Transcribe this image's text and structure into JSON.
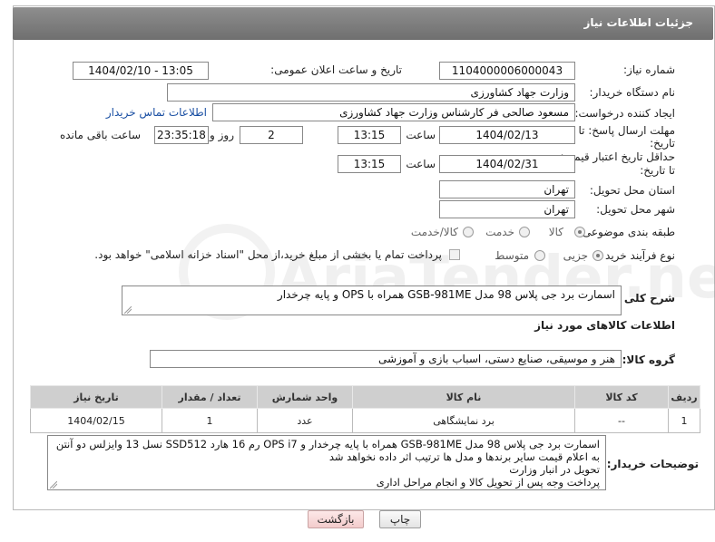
{
  "header": {
    "title": "جزئیات اطلاعات نیاز"
  },
  "form": {
    "need_number": {
      "label": "شماره نیاز:",
      "value": "1104000006000043"
    },
    "announce": {
      "label": "تاریخ و ساعت اعلان عمومی:",
      "value": "1404/02/10 - 13:05"
    },
    "buyer_org": {
      "label": "نام دستگاه خریدار:",
      "value": "وزارت جهاد کشاورزی"
    },
    "requester": {
      "label": "ایجاد کننده درخواست:",
      "value": "مسعود صالحی فر کارشناس وزارت جهاد کشاورزی",
      "contact_link": "اطلاعات تماس خریدار"
    },
    "reply_deadline": {
      "label_line1": "مهلت ارسال پاسخ: تا",
      "label_line2": "تاریخ:",
      "date": "1404/02/13",
      "time_label": "ساعت",
      "time": "13:15",
      "days": "2",
      "days_label": "روز و",
      "remaining": "23:35:18",
      "remaining_label": "ساعت باقی مانده"
    },
    "price_validity": {
      "label_line1": "حداقل تاریخ اعتبار قیمت:",
      "label_line2": "تا تاریخ:",
      "date": "1404/02/31",
      "time_label": "ساعت",
      "time": "13:15"
    },
    "delivery_province": {
      "label": "استان محل تحویل:",
      "value": "تهران"
    },
    "delivery_city": {
      "label": "شهر محل تحویل:",
      "value": "تهران"
    },
    "category": {
      "label": "طبقه بندی موضوعی:",
      "options": [
        "کالا",
        "خدمت",
        "کالا/خدمت"
      ],
      "selected": "کالا"
    },
    "purchase_process": {
      "label": "نوع فرآیند خرید :",
      "options": [
        "جزیی",
        "متوسط"
      ],
      "selected": "جزیی",
      "payment_note": "پرداخت تمام یا بخشی از مبلغ خرید،از محل \"اسناد خزانه اسلامی\" خواهد بود."
    }
  },
  "summary": {
    "label": "شرح کلی نیاز:",
    "value": "اسمارت برد جی پلاس 98 مدل GSB-981ME همراه با OPS و پایه چرخدار"
  },
  "goods_section": {
    "title": "اطلاعات کالاهای مورد نیاز",
    "group_label": "گروه کالا:",
    "group_value": "هنر و موسیقی، صنایع دستی، اسباب بازی و آموزشی"
  },
  "table": {
    "headers": [
      "ردیف",
      "کد کالا",
      "نام کالا",
      "واحد شمارش",
      "تعداد / مقدار",
      "تاریخ نیاز"
    ],
    "rows": [
      [
        "1",
        "--",
        "برد نمایشگاهی",
        "عدد",
        "1",
        "1404/02/15"
      ]
    ]
  },
  "buyer_notes": {
    "label": "توضیحات خریدار:",
    "lines": [
      "اسمارت برد جی پلاس 98 مدل GSB-981ME همراه با پایه چرخدار و OPS i7 رم 16 هارد SSD512 نسل 13 وایزلس دو آنتن",
      "به اعلام قیمت سایر برندها و مدل ها ترتیب اثر داده نخواهد شد",
      "تحویل در انبار وزارت",
      "پرداخت وجه پس از تحویل کالا و انجام مراحل اداری"
    ]
  },
  "buttons": {
    "print": "چاپ",
    "back": "بازگشت"
  },
  "watermark": {
    "text": "AriaTender.neT"
  }
}
